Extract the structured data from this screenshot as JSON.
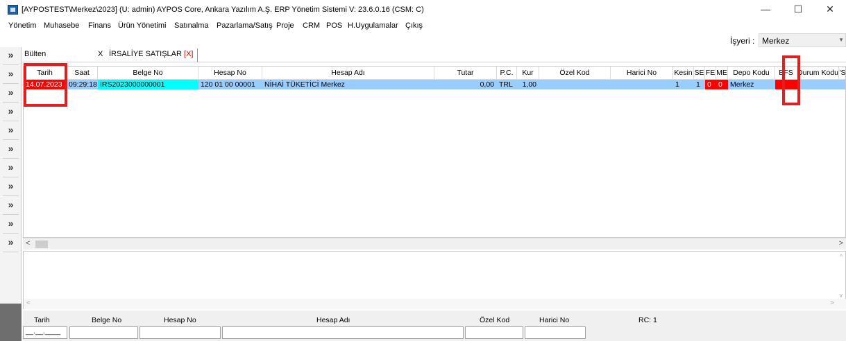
{
  "window": {
    "title": "[AYPOSTEST\\Merkez\\2023] (U: admin) AYPOS Core, Ankara Yazılım A.Ş. ERP Yönetim Sistemi V: 23.6.0.16 (CSM: C)",
    "minimize": "—",
    "maximize": "☐",
    "close": "✕"
  },
  "menu": {
    "items": [
      "Yönetim",
      "Muhasebe",
      "Finans",
      "Ürün Yönetimi",
      "Satınalma",
      "Pazarlama/Satış",
      "Proje",
      "CRM",
      "POS",
      "H.Uygulamalar",
      "Çıkış"
    ]
  },
  "isyeri": {
    "label": "İşyeri :",
    "value": "Merkez"
  },
  "rail": {
    "button": "»"
  },
  "tabs": {
    "bulten": "Bülten",
    "close_x": "X",
    "irsaliye": "İRSALİYE SATIŞLAR",
    "irsaliye_close": "[X]"
  },
  "grid": {
    "columns": [
      "Tarih",
      "Saat",
      "Belge No",
      "Hesap No",
      "Hesap Adı",
      "Tutar",
      "P.C.",
      "Kur",
      "Özel Kod",
      "Harici No",
      "Kesin",
      "SE",
      "FE",
      "ME",
      "Depo Kodu",
      "EFS",
      "Durum Kodu",
      "'S"
    ],
    "rows": [
      {
        "tarih": "14.07.2023",
        "saat": "09:29:18",
        "belge_no": "IRS2023000000001",
        "hesap_no": "120 01 00 00001",
        "hesap_adi": "NİHAİ TÜKETİCİ Merkez",
        "tutar": "0,00",
        "pc": "TRL",
        "kur": "1,00",
        "ozel_kod": "",
        "harici_no": "",
        "kesin": "1",
        "se": "1",
        "fe": "0",
        "me": "0",
        "depo_kodu": "Merkez",
        "efs": "",
        "durum_kodu": ""
      }
    ]
  },
  "scroll": {
    "left": "<",
    "right": ">"
  },
  "detail": {
    "up": "^",
    "down": "v",
    "left": "<",
    "right": ">"
  },
  "filter": {
    "labels": {
      "tarih": "Tarih",
      "belge_no": "Belge No",
      "hesap_no": "Hesap No",
      "hesap_adi": "Hesap Adı",
      "ozel_kod": "Özel Kod",
      "harici_no": "Harici No",
      "rc": "RC: 1"
    },
    "date_mask": "__.__.____"
  },
  "colors": {
    "row_selected": "#99ccff",
    "red_cell": "#ff0000",
    "cyan_cell": "#00ffff",
    "highlight_box": "#e02020"
  }
}
